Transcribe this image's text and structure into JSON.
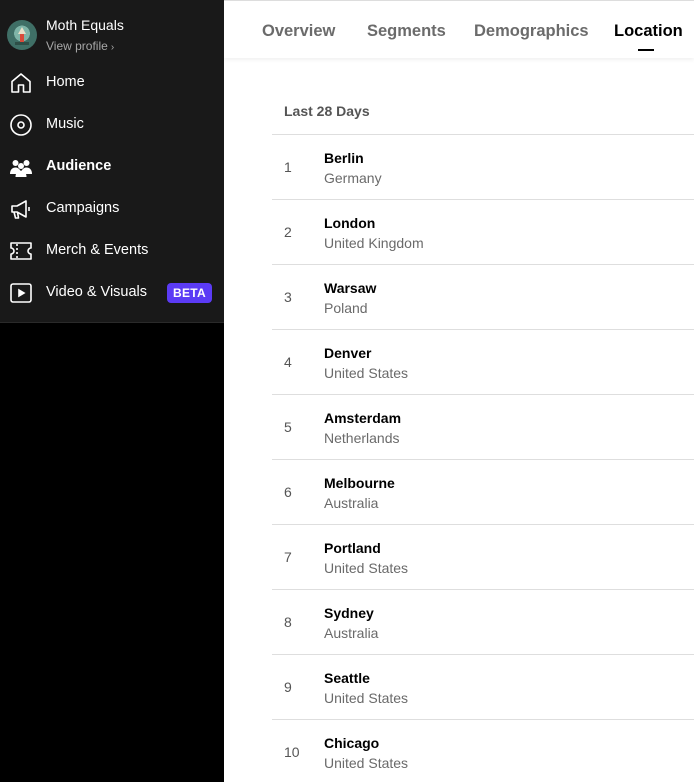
{
  "profile": {
    "name": "Moth Equals",
    "link": "View profile"
  },
  "nav": [
    {
      "label": "Home",
      "icon": "home-icon",
      "active": false
    },
    {
      "label": "Music",
      "icon": "music-disc-icon",
      "active": false
    },
    {
      "label": "Audience",
      "icon": "audience-icon",
      "active": true
    },
    {
      "label": "Campaigns",
      "icon": "megaphone-icon",
      "active": false
    },
    {
      "label": "Merch & Events",
      "icon": "ticket-icon",
      "active": false
    },
    {
      "label": "Video & Visuals",
      "icon": "video-icon",
      "active": false,
      "badge": "BETA"
    }
  ],
  "tabs": [
    "Overview",
    "Segments",
    "Demographics",
    "Location"
  ],
  "active_tab": "Location",
  "range_label": "Last 28 Days",
  "locations": [
    {
      "rank": "1",
      "city": "Berlin",
      "country": "Germany"
    },
    {
      "rank": "2",
      "city": "London",
      "country": "United Kingdom"
    },
    {
      "rank": "3",
      "city": "Warsaw",
      "country": "Poland"
    },
    {
      "rank": "4",
      "city": "Denver",
      "country": "United States"
    },
    {
      "rank": "5",
      "city": "Amsterdam",
      "country": "Netherlands"
    },
    {
      "rank": "6",
      "city": "Melbourne",
      "country": "Australia"
    },
    {
      "rank": "7",
      "city": "Portland",
      "country": "United States"
    },
    {
      "rank": "8",
      "city": "Sydney",
      "country": "Australia"
    },
    {
      "rank": "9",
      "city": "Seattle",
      "country": "United States"
    },
    {
      "rank": "10",
      "city": "Chicago",
      "country": "United States"
    }
  ],
  "colors": {
    "beta_badge": "#5b3bf5",
    "sidebar_bg": "#191919"
  }
}
